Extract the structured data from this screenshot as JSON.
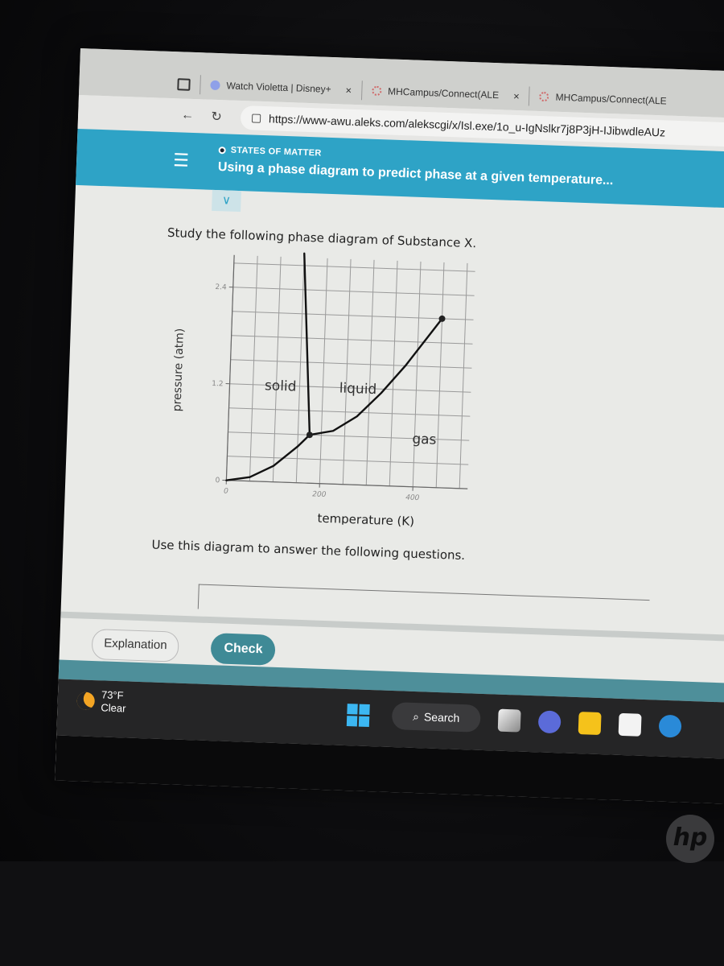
{
  "browser": {
    "tabs": [
      {
        "label": "Watch Violetta | Disney+",
        "favicon": "disney-plus-icon"
      },
      {
        "label": "MHCampus/Connect(ALE",
        "favicon": "mhcampus-icon"
      },
      {
        "label": "MHCampus/Connect(ALE",
        "favicon": "mhcampus-icon"
      }
    ],
    "close_glyph": "×",
    "back_glyph": "←",
    "refresh_glyph": "↻",
    "url": "https://www-awu.aleks.com/alekscgi/x/Isl.exe/1o_u-IgNslkr7j8P3jH-IJibwdleAUz"
  },
  "header": {
    "menu_glyph": "☰",
    "topic": "STATES OF MATTER",
    "title": "Using a phase diagram to predict phase at a given temperature..."
  },
  "collapse_glyph": "∨",
  "question": {
    "intro": "Study the following phase diagram of Substance X.",
    "outro": "Use this diagram to answer the following questions."
  },
  "buttons": {
    "explanation": "Explanation",
    "check": "Check"
  },
  "taskbar": {
    "temperature": "73°F",
    "condition": "Clear",
    "search_label": "Search",
    "search_glyph": "⌕"
  },
  "brand": "hp",
  "chart_data": {
    "type": "line",
    "title": "Phase diagram of Substance X",
    "xlabel": "temperature (K)",
    "ylabel": "pressure (atm)",
    "xlim": [
      0,
      500
    ],
    "ylim": [
      0,
      2.7
    ],
    "x_ticks": [
      0,
      200,
      400
    ],
    "y_ticks": [
      0,
      1.2,
      2.4
    ],
    "x_tick_labels": [
      "0",
      "200",
      "400"
    ],
    "y_tick_labels": [
      "0",
      "1.2",
      "2.4"
    ],
    "x_grid_step": 50,
    "y_grid_step": 0.3,
    "grid": true,
    "series": [
      {
        "name": "sublimation curve",
        "points": [
          [
            0,
            0
          ],
          [
            50,
            0.05
          ],
          [
            100,
            0.2
          ],
          [
            150,
            0.45
          ],
          [
            175,
            0.6
          ]
        ]
      },
      {
        "name": "melting curve",
        "points": [
          [
            175,
            0.6
          ],
          [
            150,
            2.85
          ]
        ]
      },
      {
        "name": "vaporization curve",
        "points": [
          [
            175,
            0.6
          ],
          [
            225,
            0.66
          ],
          [
            275,
            0.85
          ],
          [
            325,
            1.15
          ],
          [
            375,
            1.5
          ],
          [
            425,
            1.9
          ],
          [
            450,
            2.1
          ]
        ]
      }
    ],
    "points": [
      {
        "name": "triple point",
        "x": 175,
        "y": 0.6
      },
      {
        "name": "critical point",
        "x": 450,
        "y": 2.1
      }
    ],
    "region_labels": [
      {
        "text": "solid",
        "x": 75,
        "y": 1.2
      },
      {
        "text": "liquid",
        "x": 235,
        "y": 1.2
      },
      {
        "text": "gas",
        "x": 395,
        "y": 0.6
      }
    ]
  }
}
